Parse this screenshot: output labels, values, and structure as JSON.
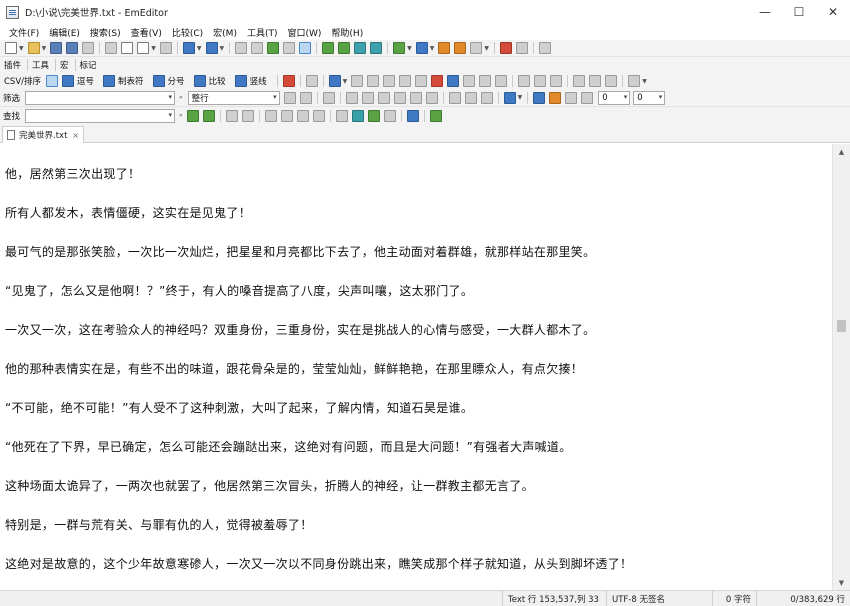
{
  "window": {
    "title": "D:\\小说\\完美世界.txt - EmEditor",
    "controls": {
      "minimize": "—",
      "maximize": "☐",
      "close": "✕"
    }
  },
  "menu": [
    "文件(F)",
    "编辑(E)",
    "搜索(S)",
    "查看(V)",
    "比较(C)",
    "宏(M)",
    "工具(T)",
    "窗口(W)",
    "帮助(H)"
  ],
  "toolbar2": {
    "plugins": "插件",
    "tools": "工具",
    "macro": "宏",
    "marker": "标记"
  },
  "toolbar3": {
    "csv": "CSV/排序",
    "comma": "逗号",
    "tab": "制表符",
    "semicolon": "分号",
    "compare": "比较",
    "vbar": "竖线"
  },
  "filter": {
    "label": "筛选",
    "value": "",
    "scope": "整行",
    "num1": "0",
    "num2": "0"
  },
  "find": {
    "label": "查找",
    "value": ""
  },
  "tab": {
    "name": "完美世界.txt",
    "close": "×"
  },
  "editor": {
    "lines": [
      "他，居然第三次出现了！",
      "所有人都发木，表情僵硬，这实在是见鬼了！",
      "最可气的是那张笑脸，一次比一次灿烂，把星星和月亮都比下去了，他主动面对着群雄，就那样站在那里笑。",
      "“见鬼了，怎么又是他啊！？”终于，有人的嗓音提高了八度，尖声叫嚷，这太邪门了。",
      "一次又一次，这在考验众人的神经吗？双重身份，三重身份，实在是挑战人的心情与感受，一大群人都木了。",
      "他的那种表情实在是，有些不出的味道，跟花骨朵是的，莹莹灿灿，鲜鲜艳艳，在那里瞟众人，有点欠揍！",
      "“不可能，绝不可能！”有人受不了这种刺激，大叫了起来，了解内情，知道石昊是谁。",
      "“他死在了下界，早已确定，怎么可能还会蹦跶出来，这绝对有问题，而且是大问题！”有强者大声喊道。",
      "这种场面太诡异了，一两次也就罢了，他居然第三次冒头，折腾人的神经，让一群教主都无言了。",
      "特别是，一群与荒有关、与罪有仇的人，觉得被羞辱了！",
      "这绝对是故意的，这个少年故意寒碜人，一次又一次以不同身份跳出来，瞧笑成那个样子就知道，从头到脚坏透了！"
    ]
  },
  "status": {
    "position": "Text 行 153,537,列 33",
    "encoding": "UTF-8 无签名",
    "chars": "0 字符",
    "lines": "0/383,629 行"
  },
  "colors": {
    "chrome": "#f3f3f3",
    "editor_bg": "#ffffff",
    "text": "#111111",
    "accent": "#4a86c8"
  }
}
